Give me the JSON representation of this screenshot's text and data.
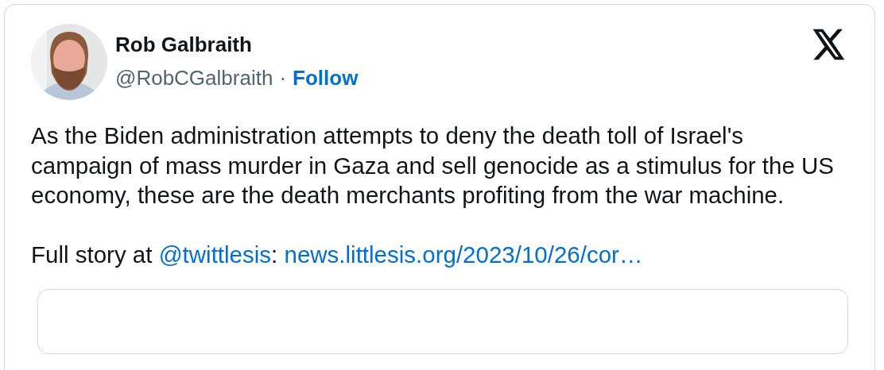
{
  "author": {
    "name": "Rob Galbraith",
    "handle": "@RobCGalbraith",
    "separator": "·",
    "follow": "Follow"
  },
  "paragraphs": [
    [
      {
        "kind": "text",
        "text": "As the Biden administration attempts to deny the death toll of Israel's campaign of mass murder in Gaza and sell genocide as a stimulus for the US economy, these are the death merchants profiting from the war machine."
      }
    ],
    [
      {
        "kind": "text",
        "text": "Full story at "
      },
      {
        "kind": "mention",
        "text": "@twittlesis"
      },
      {
        "kind": "text",
        "text": ": "
      },
      {
        "kind": "link",
        "text": "news.littlesis.org/2023/10/26/cor…"
      }
    ]
  ]
}
